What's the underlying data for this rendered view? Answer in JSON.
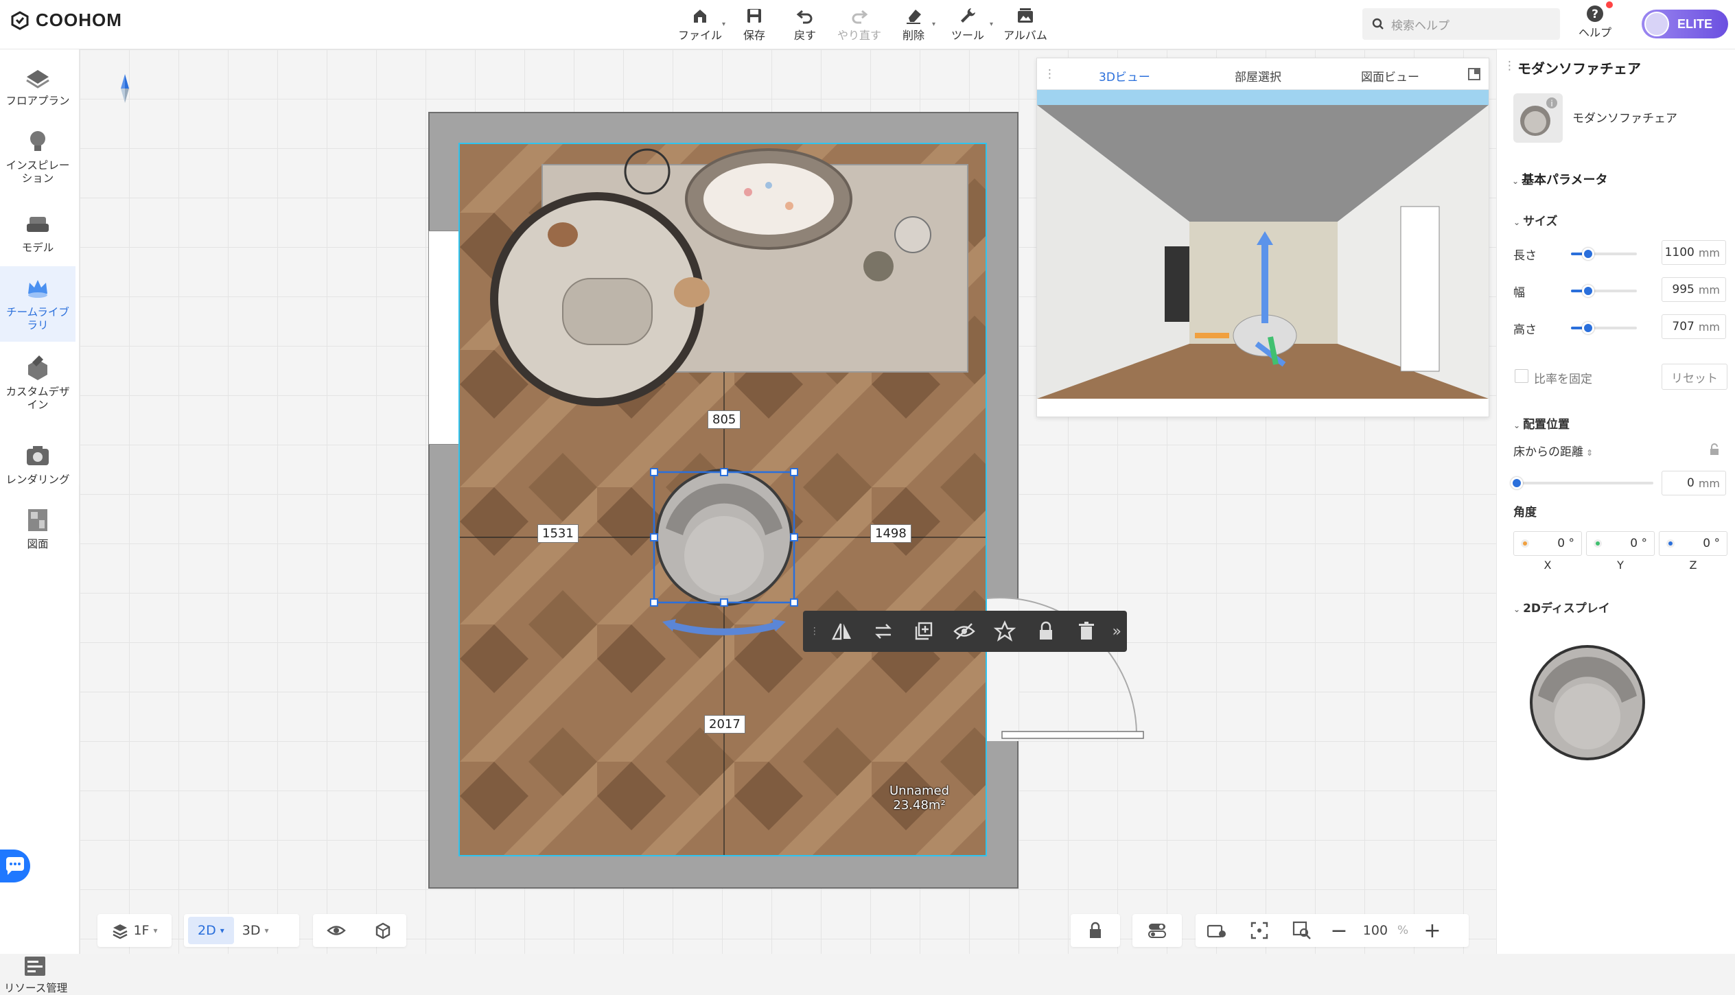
{
  "app": {
    "logo_text": "COOHOM"
  },
  "toolbar": {
    "file": "ファイル",
    "save": "保存",
    "undo": "戻す",
    "redo": "やり直す",
    "delete": "削除",
    "tools": "ツール",
    "album": "アルバム"
  },
  "search": {
    "placeholder": "検索ヘルプ"
  },
  "help": {
    "label": "ヘルプ"
  },
  "account": {
    "badge": "ELITE"
  },
  "sidebar": {
    "items": [
      {
        "label": "フロアプラン"
      },
      {
        "label": "インスピレーション"
      },
      {
        "label": "モデル"
      },
      {
        "label": "チームライブラリ"
      },
      {
        "label": "カスタムデザイン"
      },
      {
        "label": "レンダリング"
      },
      {
        "label": "図面"
      }
    ],
    "resource": "リソース管理"
  },
  "plan": {
    "dims": {
      "top": "805",
      "left": "1531",
      "right": "1498",
      "bottom": "2017"
    },
    "room_name": "Unnamed",
    "room_area": "23.48m²"
  },
  "view3d": {
    "tabs": [
      "3Dビュー",
      "部屋選択",
      "図面ビュー"
    ]
  },
  "bottom": {
    "floor": "1F",
    "mode2d": "2D",
    "mode3d": "3D",
    "zoom": "100",
    "zoom_unit": "%"
  },
  "panel": {
    "title": "モダンソファチェア",
    "item_name": "モダンソファチェア",
    "basic_params": "基本パラメータ",
    "size": "サイズ",
    "length_label": "長さ",
    "length_value": "1100",
    "width_label": "幅",
    "width_value": "995",
    "height_label": "高さ",
    "height_value": "707",
    "unit": "mm",
    "lock_ratio": "比率を固定",
    "reset": "リセット",
    "placement": "配置位置",
    "floor_distance": "床からの距離",
    "floor_distance_value": "0",
    "angle": "角度",
    "angle_x": "0",
    "angle_y": "0",
    "angle_z": "0",
    "deg": "°",
    "axis_x": "X",
    "axis_y": "Y",
    "axis_z": "Z",
    "display2d": "2Dディスプレイ"
  }
}
